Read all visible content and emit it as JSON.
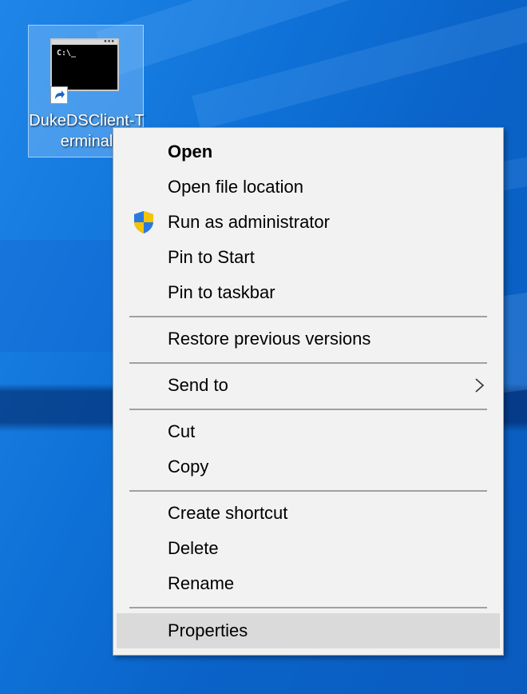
{
  "desktop": {
    "shortcut": {
      "icon": "command-prompt-icon",
      "prompt_text": "C:\\_",
      "label": "DukeDSClient-Terminal"
    }
  },
  "context_menu": {
    "items": [
      {
        "label": "Open",
        "bold": true
      },
      {
        "label": "Open file location"
      },
      {
        "label": "Run as administrator",
        "icon": "uac-shield-icon"
      },
      {
        "label": "Pin to Start"
      },
      {
        "label": "Pin to taskbar"
      },
      {
        "label": "Restore previous versions"
      },
      {
        "label": "Send to",
        "submenu": true
      },
      {
        "label": "Cut"
      },
      {
        "label": "Copy"
      },
      {
        "label": "Create shortcut"
      },
      {
        "label": "Delete"
      },
      {
        "label": "Rename"
      },
      {
        "label": "Properties",
        "highlighted": true
      }
    ]
  },
  "colors": {
    "menu_background": "#f2f2f2",
    "menu_highlight": "#dadada",
    "desktop_blue": "#0f72d8",
    "shield_blue": "#1f5fbf",
    "shield_yellow": "#f5c400"
  }
}
